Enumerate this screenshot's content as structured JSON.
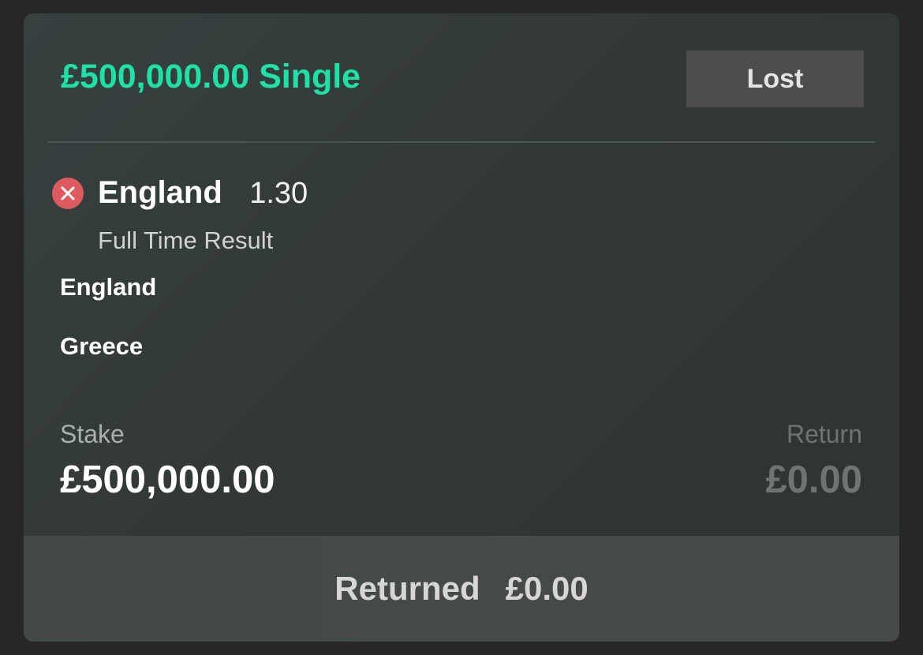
{
  "bet": {
    "title": "£500,000.00 Single",
    "status": "Lost",
    "status_icon": "close-x-icon",
    "accent_color": "#1fe0a6",
    "lost_color": "#dd5a5f"
  },
  "selection": {
    "name": "England",
    "odds": "1.30",
    "market": "Full Time Result",
    "teams": {
      "home": "England",
      "away": "Greece"
    }
  },
  "stake": {
    "label": "Stake",
    "value": "£500,000.00"
  },
  "return": {
    "label": "Return",
    "value": "£0.00"
  },
  "footer": {
    "label": "Returned",
    "value": "£0.00"
  }
}
